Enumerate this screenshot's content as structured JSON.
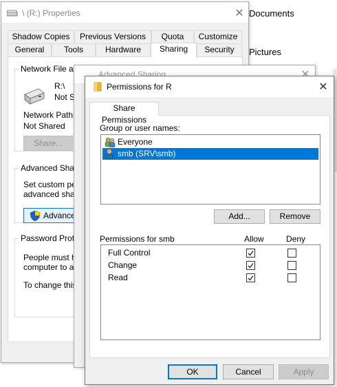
{
  "background": {
    "documents": "Documents",
    "pictures": "Pictures"
  },
  "props": {
    "title": "\\ (R:) Properties",
    "tabs_row1": [
      "Shadow Copies",
      "Previous Versions",
      "Quota",
      "Customize"
    ],
    "tabs_row2": [
      "General",
      "Tools",
      "Hardware",
      "Sharing",
      "Security"
    ],
    "active_tab": "Sharing",
    "network_group_label": "Network File and",
    "drive_name": "R:\\",
    "drive_status": "Not S",
    "network_path_label": "Network Path:",
    "network_path_value": "Not Shared",
    "share_button": "Share...",
    "advanced_group_label": "Advanced Sharin",
    "advanced_desc_1": "Set custom pem",
    "advanced_desc_2": "advanced sharir",
    "advanced_button": "Advanced",
    "password_group_label": "Password Protec",
    "password_desc_1": "People must hav",
    "password_desc_2": "computer to acc",
    "password_desc_3": "To change this s"
  },
  "advanced_sharing": {
    "title": "Advanced Sharing"
  },
  "permissions": {
    "title": "Permissions for R",
    "tab": "Share Permissions",
    "group_label": "Group or user names:",
    "users": [
      {
        "name": "Everyone",
        "icon": "users-group-icon",
        "selected": false
      },
      {
        "name": "smb (SRV\\smb)",
        "icon": "user-icon",
        "selected": true
      }
    ],
    "add_button": "Add...",
    "remove_button": "Remove",
    "perm_header": "Permissions for smb",
    "allow_header": "Allow",
    "deny_header": "Deny",
    "perms": [
      {
        "name": "Full Control",
        "allow": true,
        "deny": false
      },
      {
        "name": "Change",
        "allow": true,
        "deny": false
      },
      {
        "name": "Read",
        "allow": true,
        "deny": false
      }
    ],
    "ok_button": "OK",
    "cancel_button": "Cancel",
    "apply_button": "Apply"
  },
  "colors": {
    "selection": "#0078d7",
    "window_bg": "#f0f0f0",
    "folder_yellow": "#e8b83a"
  }
}
